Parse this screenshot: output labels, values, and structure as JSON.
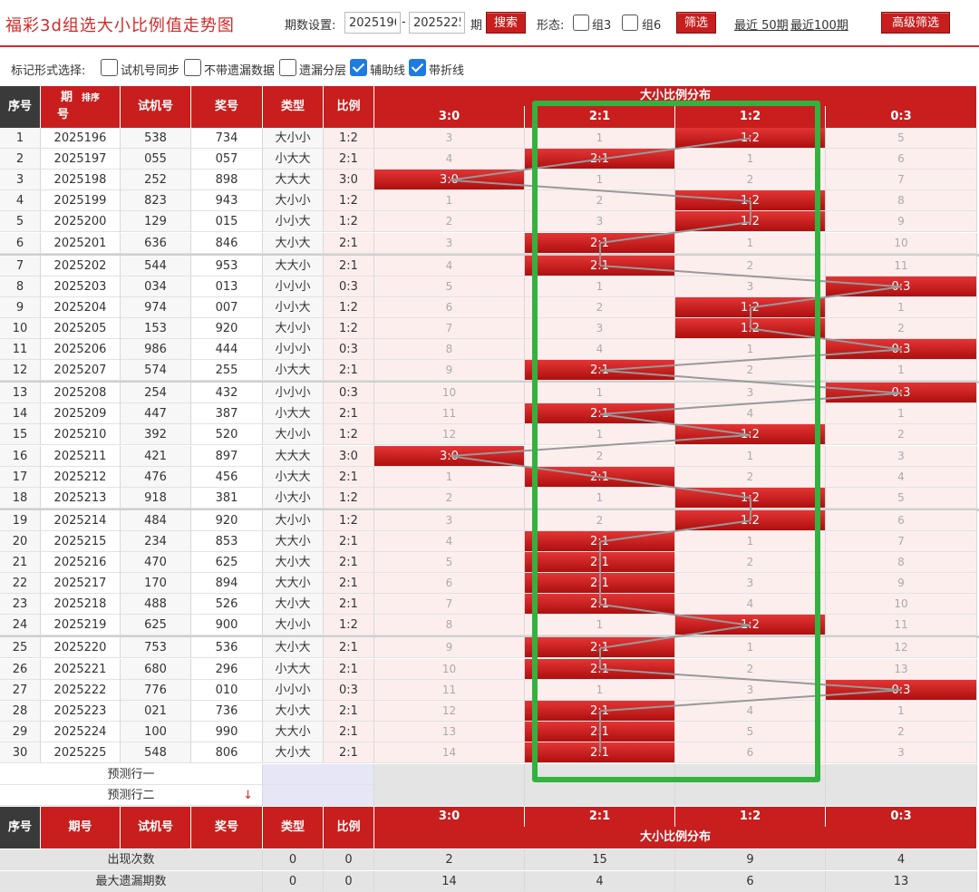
{
  "header": {
    "title": "福彩3d组选大小比例值走势图",
    "period_label": "期数设置:",
    "period_from": "2025196",
    "period_dash": "-",
    "period_to": "2025225",
    "period_unit": "期",
    "search_label": "搜索",
    "form_label": "形态:",
    "group3_label": "组3",
    "group6_label": "组6",
    "filter_label": "筛选",
    "recent50_label": "最近 50期",
    "recent100_label": "最近100期",
    "advanced_label": "高级筛选"
  },
  "markers": {
    "label": "标记形式选择:",
    "options": [
      {
        "label": "试机号同步",
        "checked": false
      },
      {
        "label": "不带遗漏数据",
        "checked": false
      },
      {
        "label": "遗漏分层",
        "checked": false
      },
      {
        "label": "辅助线",
        "checked": true
      },
      {
        "label": "带折线",
        "checked": true
      }
    ]
  },
  "table": {
    "headers": {
      "index": "序号",
      "period": "期号",
      "sort": "排序",
      "trial": "试机号",
      "draw": "奖号",
      "type": "类型",
      "ratio": "比例",
      "dist_title": "大小比例分布"
    },
    "ratio_columns": [
      "3:0",
      "2:1",
      "1:2",
      "0:3"
    ],
    "rows": [
      {
        "idx": "1",
        "period": "2025196",
        "trial": "538",
        "draw": "734",
        "type": "大小小",
        "ratio": "1:2",
        "cols": [
          "3",
          "1",
          "1:2",
          "5"
        ],
        "hit": 2
      },
      {
        "idx": "2",
        "period": "2025197",
        "trial": "055",
        "draw": "057",
        "type": "小大大",
        "ratio": "2:1",
        "cols": [
          "4",
          "2:1",
          "1",
          "6"
        ],
        "hit": 1
      },
      {
        "idx": "3",
        "period": "2025198",
        "trial": "252",
        "draw": "898",
        "type": "大大大",
        "ratio": "3:0",
        "cols": [
          "3:0",
          "1",
          "2",
          "7"
        ],
        "hit": 0
      },
      {
        "idx": "4",
        "period": "2025199",
        "trial": "823",
        "draw": "943",
        "type": "大小小",
        "ratio": "1:2",
        "cols": [
          "1",
          "2",
          "1:2",
          "8"
        ],
        "hit": 2
      },
      {
        "idx": "5",
        "period": "2025200",
        "trial": "129",
        "draw": "015",
        "type": "小小大",
        "ratio": "1:2",
        "cols": [
          "2",
          "3",
          "1:2",
          "9"
        ],
        "hit": 2
      },
      {
        "idx": "6",
        "period": "2025201",
        "trial": "636",
        "draw": "846",
        "type": "大小大",
        "ratio": "2:1",
        "cols": [
          "3",
          "2:1",
          "1",
          "10"
        ],
        "hit": 1
      },
      {
        "idx": "7",
        "period": "2025202",
        "trial": "544",
        "draw": "953",
        "type": "大大小",
        "ratio": "2:1",
        "cols": [
          "4",
          "2:1",
          "2",
          "11"
        ],
        "hit": 1
      },
      {
        "idx": "8",
        "period": "2025203",
        "trial": "034",
        "draw": "013",
        "type": "小小小",
        "ratio": "0:3",
        "cols": [
          "5",
          "1",
          "3",
          "0:3"
        ],
        "hit": 3
      },
      {
        "idx": "9",
        "period": "2025204",
        "trial": "974",
        "draw": "007",
        "type": "小小大",
        "ratio": "1:2",
        "cols": [
          "6",
          "2",
          "1:2",
          "1"
        ],
        "hit": 2
      },
      {
        "idx": "10",
        "period": "2025205",
        "trial": "153",
        "draw": "920",
        "type": "大小小",
        "ratio": "1:2",
        "cols": [
          "7",
          "3",
          "1:2",
          "2"
        ],
        "hit": 2
      },
      {
        "idx": "11",
        "period": "2025206",
        "trial": "986",
        "draw": "444",
        "type": "小小小",
        "ratio": "0:3",
        "cols": [
          "8",
          "4",
          "1",
          "0:3"
        ],
        "hit": 3
      },
      {
        "idx": "12",
        "period": "2025207",
        "trial": "574",
        "draw": "255",
        "type": "小大大",
        "ratio": "2:1",
        "cols": [
          "9",
          "2:1",
          "2",
          "1"
        ],
        "hit": 1
      },
      {
        "idx": "13",
        "period": "2025208",
        "trial": "254",
        "draw": "432",
        "type": "小小小",
        "ratio": "0:3",
        "cols": [
          "10",
          "1",
          "3",
          "0:3"
        ],
        "hit": 3
      },
      {
        "idx": "14",
        "period": "2025209",
        "trial": "447",
        "draw": "387",
        "type": "小大大",
        "ratio": "2:1",
        "cols": [
          "11",
          "2:1",
          "4",
          "1"
        ],
        "hit": 1
      },
      {
        "idx": "15",
        "period": "2025210",
        "trial": "392",
        "draw": "520",
        "type": "大小小",
        "ratio": "1:2",
        "cols": [
          "12",
          "1",
          "1:2",
          "2"
        ],
        "hit": 2
      },
      {
        "idx": "16",
        "period": "2025211",
        "trial": "421",
        "draw": "897",
        "type": "大大大",
        "ratio": "3:0",
        "cols": [
          "3:0",
          "2",
          "1",
          "3"
        ],
        "hit": 0
      },
      {
        "idx": "17",
        "period": "2025212",
        "trial": "476",
        "draw": "456",
        "type": "小大大",
        "ratio": "2:1",
        "cols": [
          "1",
          "2:1",
          "2",
          "4"
        ],
        "hit": 1
      },
      {
        "idx": "18",
        "period": "2025213",
        "trial": "918",
        "draw": "381",
        "type": "小大小",
        "ratio": "1:2",
        "cols": [
          "2",
          "1",
          "1:2",
          "5"
        ],
        "hit": 2
      },
      {
        "idx": "19",
        "period": "2025214",
        "trial": "484",
        "draw": "920",
        "type": "大小小",
        "ratio": "1:2",
        "cols": [
          "3",
          "2",
          "1:2",
          "6"
        ],
        "hit": 2
      },
      {
        "idx": "20",
        "period": "2025215",
        "trial": "234",
        "draw": "853",
        "type": "大大小",
        "ratio": "2:1",
        "cols": [
          "4",
          "2:1",
          "1",
          "7"
        ],
        "hit": 1
      },
      {
        "idx": "21",
        "period": "2025216",
        "trial": "470",
        "draw": "625",
        "type": "大小大",
        "ratio": "2:1",
        "cols": [
          "5",
          "2:1",
          "2",
          "8"
        ],
        "hit": 1
      },
      {
        "idx": "22",
        "period": "2025217",
        "trial": "170",
        "draw": "894",
        "type": "大大小",
        "ratio": "2:1",
        "cols": [
          "6",
          "2:1",
          "3",
          "9"
        ],
        "hit": 1
      },
      {
        "idx": "23",
        "period": "2025218",
        "trial": "488",
        "draw": "526",
        "type": "大小大",
        "ratio": "2:1",
        "cols": [
          "7",
          "2:1",
          "4",
          "10"
        ],
        "hit": 1
      },
      {
        "idx": "24",
        "period": "2025219",
        "trial": "625",
        "draw": "900",
        "type": "大小小",
        "ratio": "1:2",
        "cols": [
          "8",
          "1",
          "1:2",
          "11"
        ],
        "hit": 2
      },
      {
        "idx": "25",
        "period": "2025220",
        "trial": "753",
        "draw": "536",
        "type": "大小大",
        "ratio": "2:1",
        "cols": [
          "9",
          "2:1",
          "1",
          "12"
        ],
        "hit": 1
      },
      {
        "idx": "26",
        "period": "2025221",
        "trial": "680",
        "draw": "296",
        "type": "小大大",
        "ratio": "2:1",
        "cols": [
          "10",
          "2:1",
          "2",
          "13"
        ],
        "hit": 1
      },
      {
        "idx": "27",
        "period": "2025222",
        "trial": "776",
        "draw": "010",
        "type": "小小小",
        "ratio": "0:3",
        "cols": [
          "11",
          "1",
          "3",
          "0:3"
        ],
        "hit": 3
      },
      {
        "idx": "28",
        "period": "2025223",
        "trial": "021",
        "draw": "736",
        "type": "大小大",
        "ratio": "2:1",
        "cols": [
          "12",
          "2:1",
          "4",
          "1"
        ],
        "hit": 1
      },
      {
        "idx": "29",
        "period": "2025224",
        "trial": "100",
        "draw": "990",
        "type": "大大小",
        "ratio": "2:1",
        "cols": [
          "13",
          "2:1",
          "5",
          "2"
        ],
        "hit": 1
      },
      {
        "idx": "30",
        "period": "2025225",
        "trial": "548",
        "draw": "806",
        "type": "大小大",
        "ratio": "2:1",
        "cols": [
          "14",
          "2:1",
          "6",
          "3"
        ],
        "hit": 1
      }
    ],
    "predict1": "预测行一",
    "predict2": "预测行二",
    "stats": [
      {
        "label": "出现次数",
        "type": "0",
        "ratio": "0",
        "cols": [
          "2",
          "15",
          "9",
          "4"
        ]
      },
      {
        "label": "最大遗漏期数",
        "type": "0",
        "ratio": "0",
        "cols": [
          "14",
          "4",
          "6",
          "13"
        ]
      }
    ]
  },
  "colors": {
    "accent": "#c81e1e",
    "highlight_box": "#33b240",
    "line": "#999999"
  }
}
